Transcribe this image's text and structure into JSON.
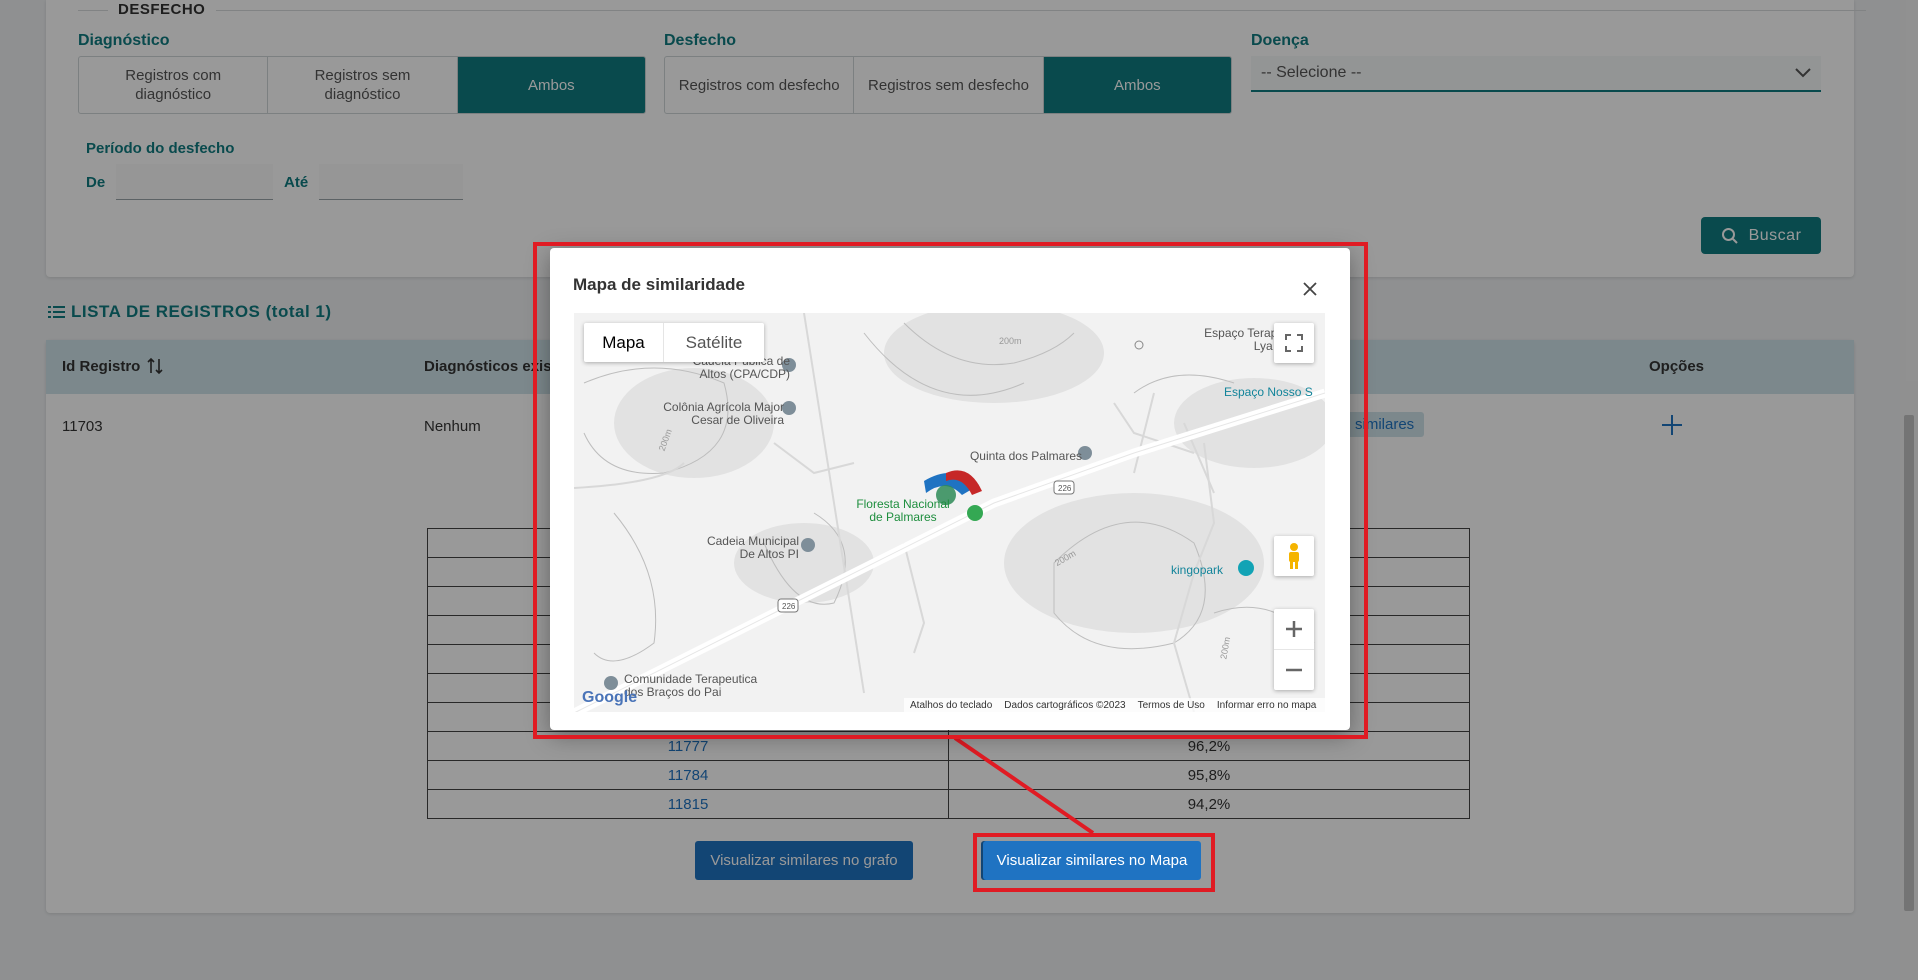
{
  "filters": {
    "section_title": "DESFECHO",
    "diagnostico": {
      "label": "Diagnóstico",
      "options": [
        "Registros com diagnóstico",
        "Registros sem diagnóstico",
        "Ambos"
      ],
      "selected": "Ambos"
    },
    "desfecho": {
      "label": "Desfecho",
      "options": [
        "Registros com desfecho",
        "Registros sem desfecho",
        "Ambos"
      ],
      "selected": "Ambos"
    },
    "doenca": {
      "label": "Doença",
      "value": "-- Selecione --"
    },
    "periodo": {
      "label": "Período do desfecho",
      "de_label": "De",
      "ate_label": "Até",
      "de_value": "",
      "ate_value": ""
    },
    "search_button": "Buscar"
  },
  "list": {
    "title": "LISTA DE REGISTROS (total 1)",
    "columns": [
      "Id Registro",
      "Diagnósticos exis",
      "Opções"
    ],
    "row": {
      "id": "11703",
      "diagnosticos": "Nenhum",
      "similar_tag": "similares",
      "options_icon": "plus-icon"
    }
  },
  "similarity_table": [
    {
      "id": "11777",
      "score": "96,2%"
    },
    {
      "id": "11784",
      "score": "95,8%"
    },
    {
      "id": "11815",
      "score": "94,2%"
    }
  ],
  "actions": {
    "graph_button": "Visualizar similares no grafo",
    "map_button": "Visualizar similares no Mapa"
  },
  "modal": {
    "title": "Mapa de similaridade",
    "map": {
      "type_tabs": [
        "Mapa",
        "Satélite"
      ],
      "selected_type": "Mapa",
      "places": {
        "cadeia_publica": "Cadeia Pública de Altos (CPA/CDP)",
        "colonia_1": "Colônia Agrícola Major",
        "colonia_2": "Cesar de Oliveira",
        "quinta": "Quinta dos Palmares",
        "floresta_1": "Floresta Nacional",
        "floresta_2": "de Palmares",
        "cadeia_municipal_1": "Cadeia Municipal",
        "cadeia_municipal_2": "De Altos PI",
        "kingopark": "kingopark",
        "espaco_terapeutico_1": "Espaço Terape",
        "espaco_terapeutico_2": "Lya S",
        "espaco_nosso": "Espaço Nosso S",
        "comunidade_1": "Comunidade Terapeutica",
        "comunidade_2": "dos Braços do Pai"
      },
      "road_label": "226",
      "contours": [
        "200m",
        "200m",
        "200m",
        "200m"
      ],
      "logo": "Google",
      "attribution": [
        "Atalhos do teclado",
        "Dados cartográficos ©2023",
        "Termos de Uso",
        "Informar erro no mapa"
      ]
    }
  },
  "colors": {
    "accent": "#0f7c80",
    "button_blue": "#1f73c2",
    "highlight_red": "#e01b23"
  }
}
